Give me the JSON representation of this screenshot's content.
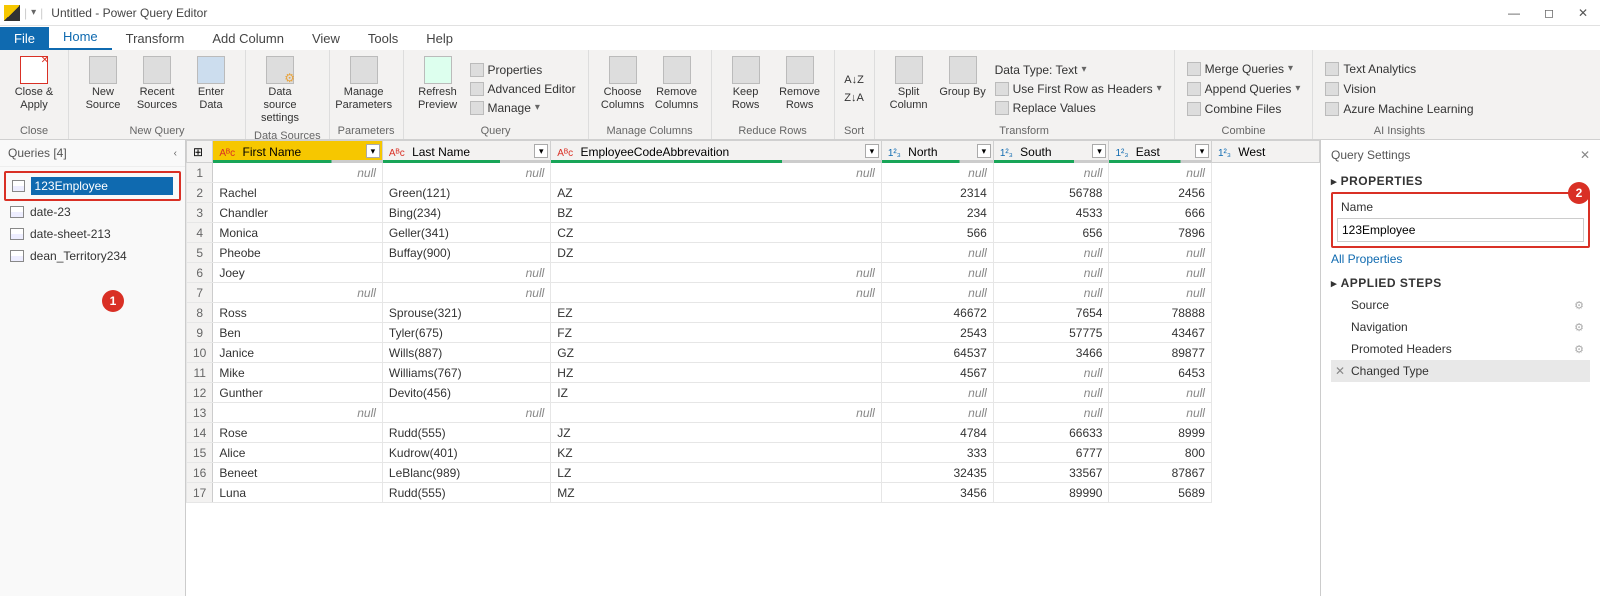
{
  "window": {
    "title": "Untitled - Power Query Editor"
  },
  "tabs": {
    "file": "File",
    "home": "Home",
    "transform": "Transform",
    "addcol": "Add Column",
    "view": "View",
    "tools": "Tools",
    "help": "Help"
  },
  "ribbon": {
    "close_apply": "Close &\nApply",
    "close_group": "Close",
    "new_source": "New\nSource",
    "recent_sources": "Recent\nSources",
    "enter_data": "Enter\nData",
    "newquery_group": "New Query",
    "ds_settings": "Data source\nsettings",
    "ds_group": "Data Sources",
    "manage_params": "Manage\nParameters",
    "params_group": "Parameters",
    "refresh": "Refresh\nPreview",
    "properties": "Properties",
    "adv_editor": "Advanced Editor",
    "manage": "Manage",
    "query_group": "Query",
    "choose_cols": "Choose\nColumns",
    "remove_cols": "Remove\nColumns",
    "mc_group": "Manage Columns",
    "keep_rows": "Keep\nRows",
    "remove_rows": "Remove\nRows",
    "rr_group": "Reduce Rows",
    "sort_group": "Sort",
    "split": "Split\nColumn",
    "group_by": "Group\nBy",
    "datatype": "Data Type: Text",
    "first_row": "Use First Row as Headers",
    "replace": "Replace Values",
    "transform_group": "Transform",
    "merge": "Merge Queries",
    "append": "Append Queries",
    "combine_files": "Combine Files",
    "combine_group": "Combine",
    "text_an": "Text Analytics",
    "vision": "Vision",
    "aml": "Azure Machine Learning",
    "ai_group": "AI Insights"
  },
  "queries": {
    "header": "Queries [4]",
    "items": [
      "123Employee",
      "date-23",
      "date-sheet-213",
      "dean_Territory234"
    ]
  },
  "columns": [
    {
      "name": "First Name",
      "type": "text",
      "selected": true
    },
    {
      "name": "Last Name",
      "type": "text"
    },
    {
      "name": "EmployeeCodeAbbrevaition",
      "type": "text"
    },
    {
      "name": "North",
      "type": "num"
    },
    {
      "name": "South",
      "type": "num"
    },
    {
      "name": "East",
      "type": "num"
    },
    {
      "name": "West",
      "type": "num"
    }
  ],
  "rows": [
    [
      null,
      null,
      null,
      null,
      null,
      null
    ],
    [
      "Rachel",
      "Green(121)",
      "AZ",
      "2314",
      "56788",
      "2456"
    ],
    [
      "Chandler",
      "Bing(234)",
      "BZ",
      "234",
      "4533",
      "666"
    ],
    [
      "Monica",
      "Geller(341)",
      "CZ",
      "566",
      "656",
      "7896"
    ],
    [
      "Pheobe",
      "Buffay(900)",
      "DZ",
      null,
      null,
      null
    ],
    [
      "Joey",
      null,
      null,
      null,
      null,
      null
    ],
    [
      null,
      null,
      null,
      null,
      null,
      null
    ],
    [
      "Ross",
      "Sprouse(321)",
      "EZ",
      "46672",
      "7654",
      "78888"
    ],
    [
      "Ben",
      "Tyler(675)",
      "FZ",
      "2543",
      "57775",
      "43467"
    ],
    [
      "Janice",
      "Wills(887)",
      "GZ",
      "64537",
      "3466",
      "89877"
    ],
    [
      "Mike",
      "Williams(767)",
      "HZ",
      "4567",
      null,
      "6453"
    ],
    [
      "Gunther",
      "Devito(456)",
      "IZ",
      null,
      null,
      null
    ],
    [
      null,
      null,
      null,
      null,
      null,
      null
    ],
    [
      "Rose",
      "Rudd(555)",
      "JZ",
      "4784",
      "66633",
      "8999"
    ],
    [
      "Alice",
      "Kudrow(401)",
      "KZ",
      "333",
      "6777",
      "800"
    ],
    [
      "Beneet",
      "LeBlanc(989)",
      "LZ",
      "32435",
      "33567",
      "87867"
    ],
    [
      "Luna",
      "Rudd(555)",
      "MZ",
      "3456",
      "89990",
      "5689"
    ]
  ],
  "settings": {
    "title": "Query Settings",
    "prop_section": "PROPERTIES",
    "name_label": "Name",
    "name_value": "123Employee",
    "all_props": "All Properties",
    "steps_section": "APPLIED STEPS",
    "steps": [
      "Source",
      "Navigation",
      "Promoted Headers",
      "Changed Type"
    ]
  },
  "callouts": {
    "one": "1",
    "two": "2"
  }
}
